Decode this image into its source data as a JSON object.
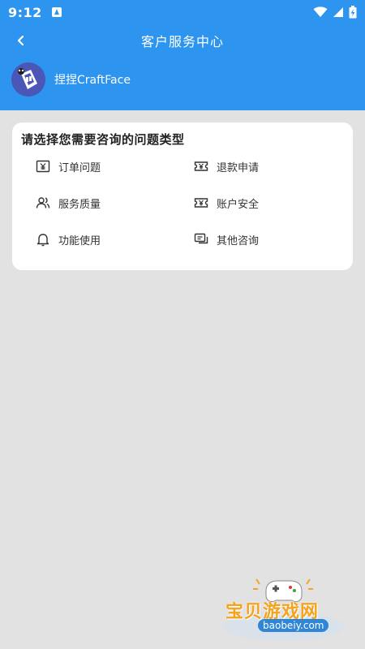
{
  "status_bar": {
    "time": "9:12"
  },
  "header": {
    "title": "客户服务中心",
    "app_name": "捏捏CraftFace"
  },
  "card": {
    "title": "请选择您需要咨询的问题类型",
    "options": [
      {
        "label": "订单问题",
        "icon": "order-yen-icon"
      },
      {
        "label": "退款申请",
        "icon": "refund-ticket-icon"
      },
      {
        "label": "服务质量",
        "icon": "people-icon"
      },
      {
        "label": "账户安全",
        "icon": "account-ticket-icon"
      },
      {
        "label": "功能使用",
        "icon": "bell-icon"
      },
      {
        "label": "其他咨询",
        "icon": "chat-icon"
      }
    ]
  },
  "watermark": {
    "text": "宝贝游戏网",
    "url": "baobeiy.com"
  },
  "colors": {
    "primary": "#2d95f0",
    "background": "#e2e2e2",
    "card": "#ffffff"
  }
}
